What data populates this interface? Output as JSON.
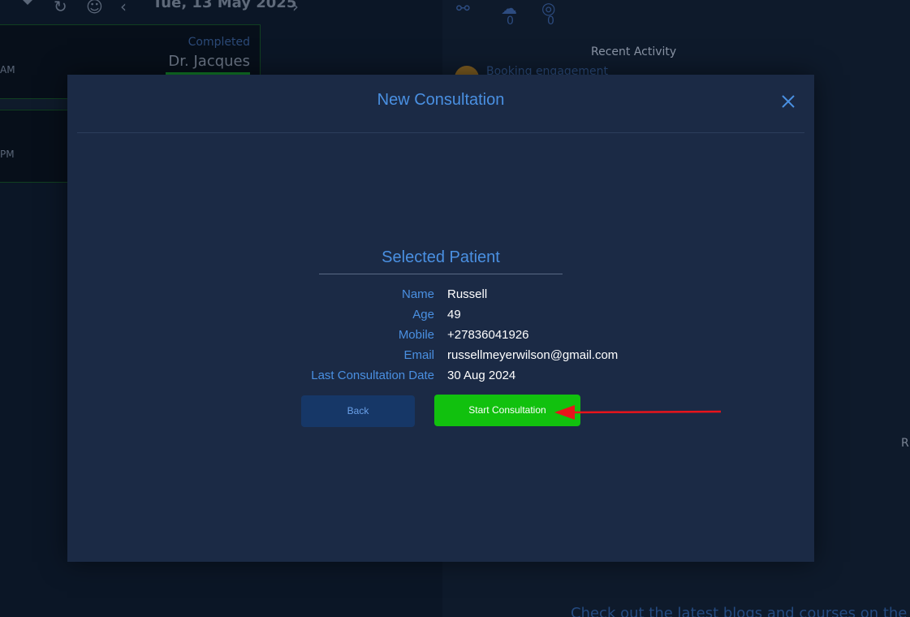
{
  "background": {
    "date": "Tue, 13 May 2025",
    "cards": [
      {
        "status": "Completed",
        "doctor": "Dr. Jacques",
        "time": "AM"
      },
      {
        "time": "PM"
      }
    ],
    "panel": {
      "counts": [
        "0",
        "0"
      ],
      "recent_activity": "Recent Activity",
      "booking": "Booking engagement",
      "blog_text": "Check out the latest blogs and courses on the",
      "edge_letter": "R"
    }
  },
  "modal": {
    "title": "New Consultation",
    "selected_patient_title": "Selected Patient",
    "details": [
      {
        "label": "Name",
        "value": "Russell"
      },
      {
        "label": "Age",
        "value": "49"
      },
      {
        "label": "Mobile",
        "value": "+27836041926"
      },
      {
        "label": "Email",
        "value": "russellmeyerwilson@gmail.com"
      },
      {
        "label": "Last Consultation Date",
        "value": "30 Aug 2024"
      }
    ],
    "back_label": "Back",
    "start_label": "Start Consultation"
  },
  "colors": {
    "accent": "#4a90e2",
    "start_button": "#11c10e",
    "back_button": "#163767",
    "annotation_arrow": "#e8141b"
  }
}
